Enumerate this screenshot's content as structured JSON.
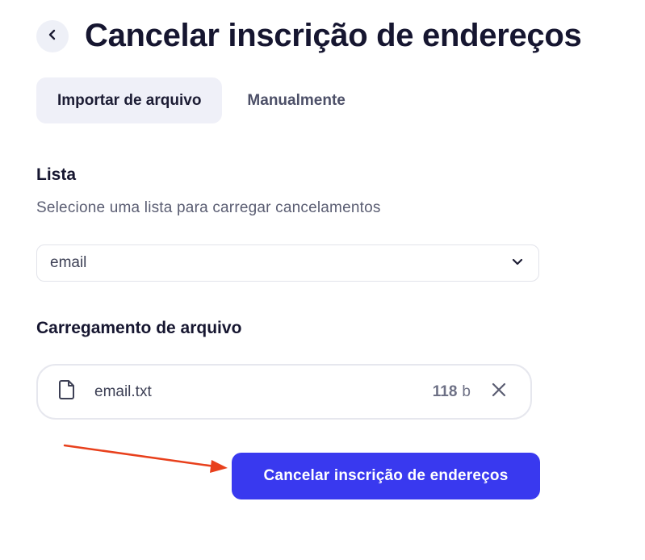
{
  "header": {
    "title": "Cancelar inscrição de endereços",
    "back_icon": "chevron-left-icon"
  },
  "tabs": [
    {
      "label": "Importar de arquivo",
      "active": true
    },
    {
      "label": "Manualmente",
      "active": false
    }
  ],
  "list_section": {
    "title": "Lista",
    "description": "Selecione uma lista para carregar cancelamentos",
    "selected_value": "email",
    "dropdown_icon": "chevron-down-icon"
  },
  "upload_section": {
    "title": "Carregamento de arquivo",
    "file": {
      "name": "email.txt",
      "size_value": "118",
      "size_unit": "b",
      "file_icon": "file-icon",
      "remove_icon": "close-icon"
    }
  },
  "submit": {
    "label": "Cancelar inscrição de endereços"
  },
  "colors": {
    "primary": "#3939ef",
    "annotation_arrow": "#e8401c",
    "title_text": "#161630",
    "tab_active_bg": "#eff0f8"
  }
}
